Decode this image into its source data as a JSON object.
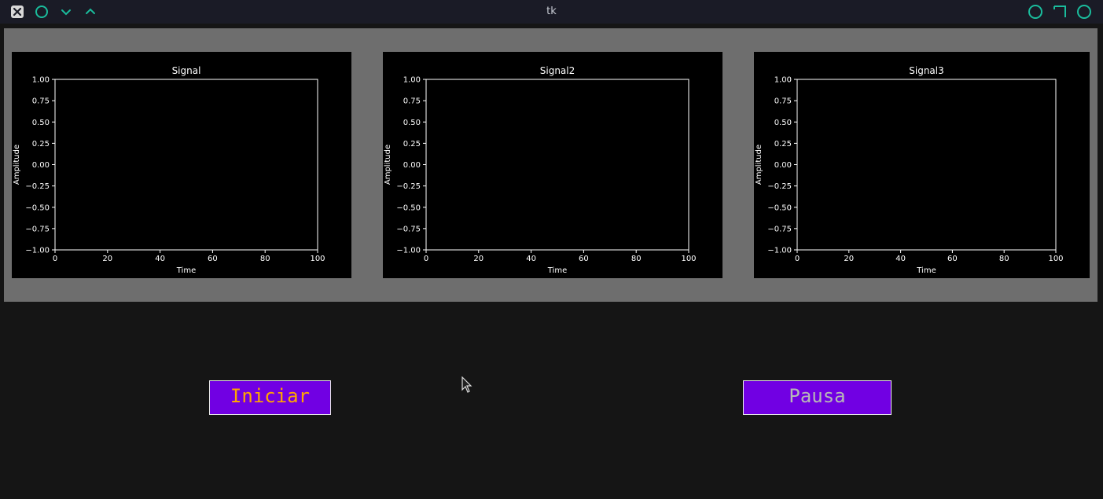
{
  "window": {
    "title": "tk",
    "icons": [
      "close-icon",
      "circle-icon",
      "chevron-down-icon",
      "chevron-up-icon",
      "circle-icon",
      "corner-icon",
      "circle-icon"
    ],
    "accent": "#1abc9c"
  },
  "charts": [
    {
      "title": "Signal",
      "xlabel": "Time",
      "ylabel": "Amplitude"
    },
    {
      "title": "Signal2",
      "xlabel": "Time",
      "ylabel": "Amplitude"
    },
    {
      "title": "Signal3",
      "xlabel": "Time",
      "ylabel": "Amplitude"
    }
  ],
  "chart_data": [
    {
      "type": "line",
      "title": "Signal",
      "xlabel": "Time",
      "ylabel": "Amplitude",
      "xlim": [
        0,
        100
      ],
      "ylim": [
        -1,
        1
      ],
      "xticks": [
        0,
        20,
        40,
        60,
        80,
        100
      ],
      "yticks": [
        -1.0,
        -0.75,
        -0.5,
        -0.25,
        0.0,
        0.25,
        0.5,
        0.75,
        1.0
      ],
      "series": []
    },
    {
      "type": "line",
      "title": "Signal2",
      "xlabel": "Time",
      "ylabel": "Amplitude",
      "xlim": [
        0,
        100
      ],
      "ylim": [
        -1,
        1
      ],
      "xticks": [
        0,
        20,
        40,
        60,
        80,
        100
      ],
      "yticks": [
        -1.0,
        -0.75,
        -0.5,
        -0.25,
        0.0,
        0.25,
        0.5,
        0.75,
        1.0
      ],
      "series": []
    },
    {
      "type": "line",
      "title": "Signal3",
      "xlabel": "Time",
      "ylabel": "Amplitude",
      "xlim": [
        0,
        100
      ],
      "ylim": [
        -1,
        1
      ],
      "xticks": [
        0,
        20,
        40,
        60,
        80,
        100
      ],
      "yticks": [
        -1.0,
        -0.75,
        -0.5,
        -0.25,
        0.0,
        0.25,
        0.5,
        0.75,
        1.0
      ],
      "series": []
    }
  ],
  "buttons": {
    "start": {
      "label": "Iniciar",
      "text_color": "#ffa500",
      "bg": "#7100e3"
    },
    "pause": {
      "label": "Pausa",
      "text_color": "#b7b7b7",
      "bg": "#7100e3"
    }
  }
}
